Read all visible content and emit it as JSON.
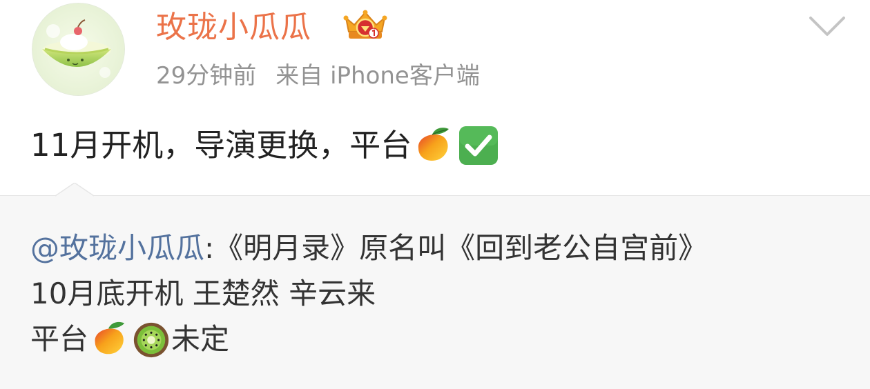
{
  "user": {
    "name": "玫珑小瓜瓜",
    "time": "29分钟前",
    "source": "来自 iPhone客户端"
  },
  "post": {
    "text_part1": "11月开机，导演更换，平台"
  },
  "quote": {
    "mention": "@玫珑小瓜瓜",
    "line1_rest": " :《明月录》原名叫《回到老公自宫前》",
    "line2": "10月底开机 王楚然 辛云来",
    "line3_prefix": "平台",
    "line3_suffix": "未定"
  },
  "icons": {
    "avatar": "melon-avatar",
    "badge": "vip-crown-badge",
    "menu": "chevron-down-icon",
    "emoji1": "mango-emoji",
    "emoji2": "check-mark-button-emoji",
    "emoji3": "kiwi-emoji"
  },
  "colors": {
    "name": "#eb7349",
    "meta": "#939393",
    "mention": "#54729e",
    "quote_bg": "#f7f7f7"
  }
}
